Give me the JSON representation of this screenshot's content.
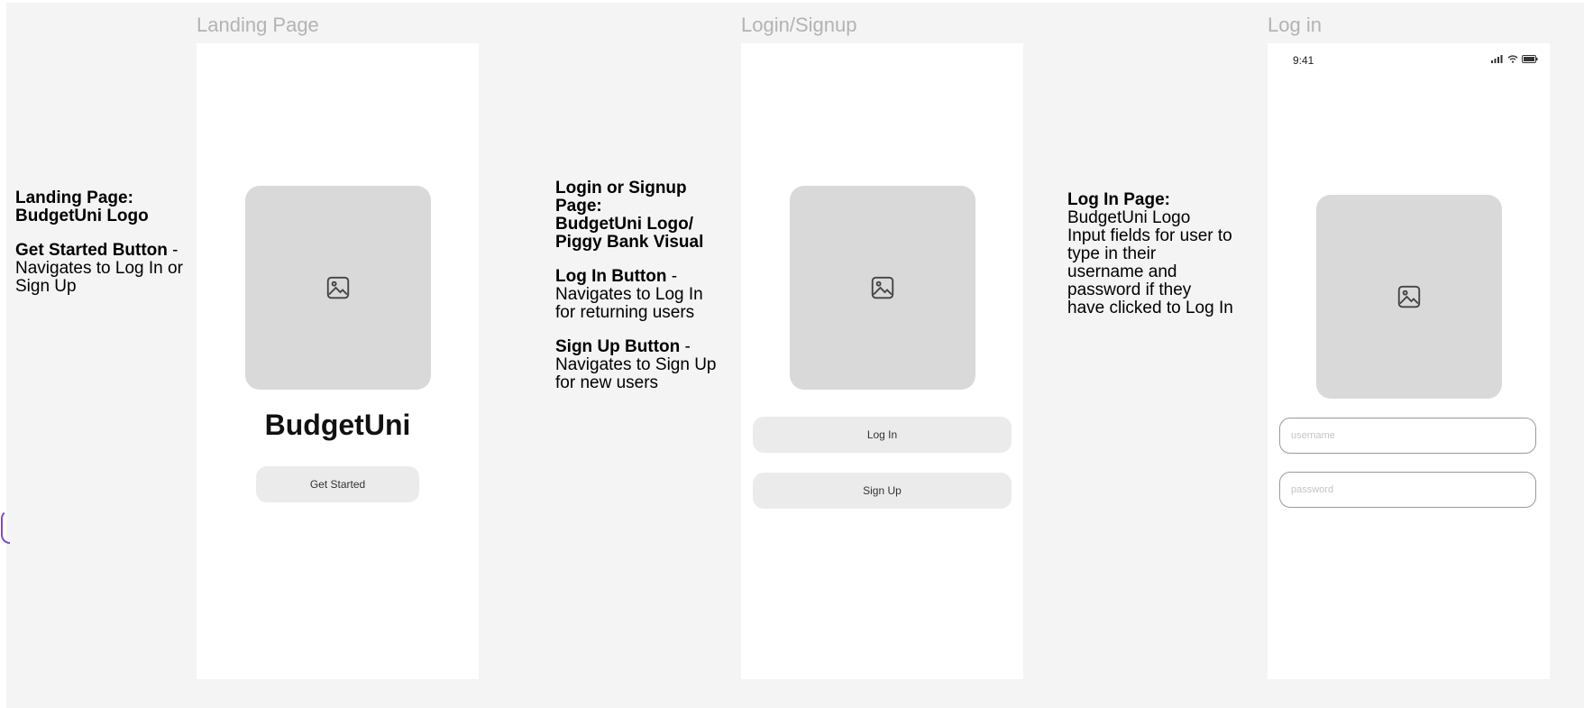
{
  "frames": [
    {
      "title": "Landing Page",
      "brand": "BudgetUni",
      "primary_button": "Get Started"
    },
    {
      "title": "Login/Signup",
      "buttons": [
        "Log In",
        "Sign Up"
      ]
    },
    {
      "title": "Log in",
      "status_time": "9:41",
      "fields": [
        {
          "placeholder": "username",
          "value": ""
        },
        {
          "placeholder": "password",
          "value": ""
        }
      ]
    }
  ],
  "notes": {
    "landing": {
      "heading": "Landing Page:\nBudgetUni Logo",
      "button_label": "Get Started Button",
      "button_desc": " -\nNavigates to Log In or\nSign Up"
    },
    "login_signup": {
      "heading": "Login or Signup\nPage:\nBudgetUni Logo/\nPiggy Bank Visual",
      "login_label": "Log In Button",
      "login_desc": " -\nNavigates to Log In\nfor returning users",
      "signup_label": "Sign Up Button",
      "signup_desc": " -\nNavigates to Sign Up\nfor new users"
    },
    "login": {
      "heading": "Log In Page:",
      "desc": "BudgetUni Logo\nInput fields for user to\ntype in their\nusername and\npassword if they\nhave clicked to Log In"
    }
  },
  "icons": [
    "image-placeholder-icon",
    "signal-icon",
    "wifi-icon",
    "battery-icon"
  ],
  "colors": {
    "canvas": "#f4f4f4",
    "frame": "#ffffff",
    "placeholder": "#d9d9d9",
    "button": "#ebebeb",
    "frame_title": "#b3b3b3"
  }
}
